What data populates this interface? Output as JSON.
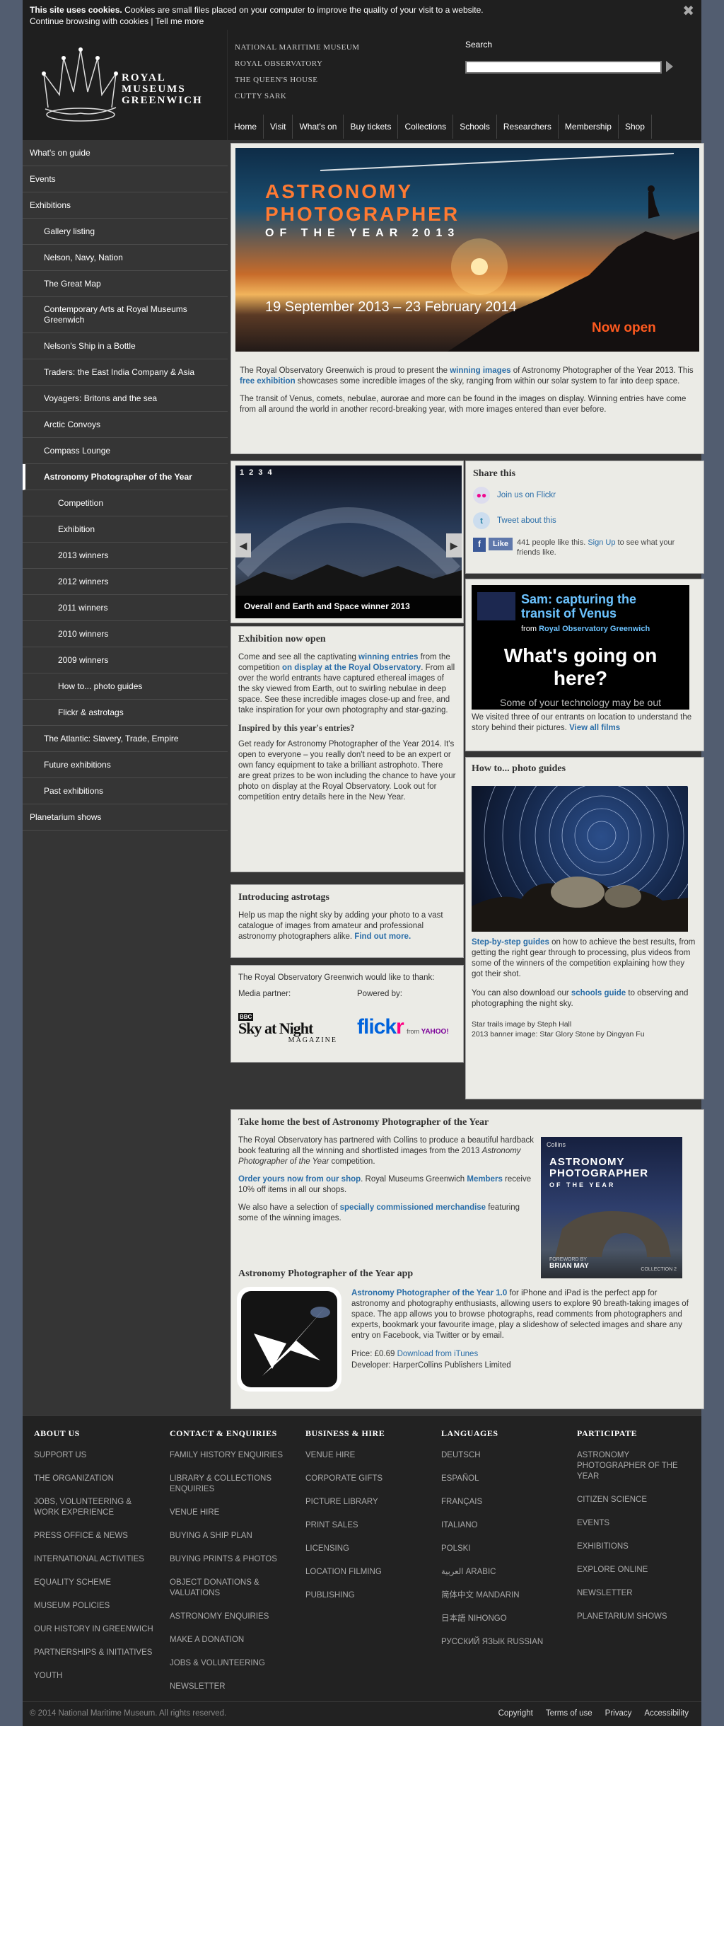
{
  "cookie": {
    "bold": "This site uses cookies.",
    "text": " Cookies are small files placed on your computer to improve the quality of your visit to a website.",
    "continue": "Continue browsing with cookies",
    "sep": " | ",
    "tell": "Tell me more",
    "close": "✖"
  },
  "logo": {
    "line1": "ROYAL",
    "line2": "MUSEUMS",
    "line3": "GREENWICH"
  },
  "sites": [
    "NATIONAL MARITIME MUSEUM",
    "ROYAL OBSERVATORY",
    "THE QUEEN'S HOUSE",
    "CUTTY SARK"
  ],
  "search": {
    "label": "Search"
  },
  "topnav": [
    "Home",
    "Visit",
    "What's on",
    "Buy tickets",
    "Collections",
    "Schools",
    "Researchers",
    "Membership",
    "Shop"
  ],
  "leftnav": [
    {
      "label": "What's on guide",
      "level": 1
    },
    {
      "label": "Events",
      "level": 1
    },
    {
      "label": "Exhibitions",
      "level": 1
    },
    {
      "label": "Gallery listing",
      "level": 2
    },
    {
      "label": "Nelson, Navy, Nation",
      "level": 2
    },
    {
      "label": "The Great Map",
      "level": 2
    },
    {
      "label": "Contemporary Arts at Royal Museums Greenwich",
      "level": 2
    },
    {
      "label": "Nelson's Ship in a Bottle",
      "level": 2
    },
    {
      "label": "Traders: the East India Company & Asia",
      "level": 2
    },
    {
      "label": "Voyagers: Britons and the sea",
      "level": 2
    },
    {
      "label": "Arctic Convoys",
      "level": 2
    },
    {
      "label": "Compass Lounge",
      "level": 2
    },
    {
      "label": "Astronomy Photographer of the Year",
      "level": 2,
      "active": true
    },
    {
      "label": "Competition",
      "level": 3
    },
    {
      "label": "Exhibition",
      "level": 3
    },
    {
      "label": "2013 winners",
      "level": 3
    },
    {
      "label": "2012 winners",
      "level": 3
    },
    {
      "label": "2011 winners",
      "level": 3
    },
    {
      "label": "2010 winners",
      "level": 3
    },
    {
      "label": "2009 winners",
      "level": 3
    },
    {
      "label": "How to... photo guides",
      "level": 3
    },
    {
      "label": "Flickr & astrotags",
      "level": 3
    },
    {
      "label": "The Atlantic: Slavery, Trade, Empire",
      "level": 2
    },
    {
      "label": "Future exhibitions",
      "level": 2
    },
    {
      "label": "Past exhibitions",
      "level": 2
    },
    {
      "label": "Planetarium shows",
      "level": 1
    }
  ],
  "hero": {
    "title1": "ASTRONOMY",
    "title2": "PHOTOGRAPHER",
    "subtitle": "OF THE YEAR 2013",
    "dates": "19 September 2013 – 23 February 2014",
    "open": "Now open"
  },
  "intro": {
    "p1a": "The Royal Observatory Greenwich is proud to present the ",
    "p1link": "winning images",
    "p1b": " of Astronomy Photographer of the Year 2013. This ",
    "p1link2": "free exhibition",
    "p1c": " showcases some incredible images of the sky, ranging from within our solar system to far into deep space.",
    "p2": "The transit of Venus, comets, nebulae, aurorae and more can be found in the images on display. Winning entries have come from all around the world in another record-breaking year, with more images entered than ever before."
  },
  "slider": {
    "dots": "1 2 3 4",
    "caption": "Overall and Earth and Space winner 2013",
    "prev": "◀",
    "next": "▶"
  },
  "share": {
    "title": "Share this",
    "flickr": "Join us on Flickr",
    "twitter": "Tweet about this",
    "like": "Like",
    "likes_a": "441 people like this. ",
    "signup": "Sign Up",
    "likes_b": " to see what your friends like."
  },
  "video": {
    "title1": "Sam: capturing the",
    "title2": "transit of Venus",
    "from": "from ",
    "channel": "Royal Observatory Greenwich",
    "overlay1": "What's going on",
    "overlay2": "here?",
    "overlay3": "Some of your technology may be out",
    "desc": "We visited three of our entrants on location to understand the story behind their pictures. ",
    "all": "View all films"
  },
  "exhibition": {
    "title": "Exhibition now open",
    "p1a": "Come and see all the captivating ",
    "p1link": "winning entries",
    "p1b": " from the competition ",
    "p1link2": "on display at the Royal Observatory",
    "p1c": ". From all over the world entrants have captured ethereal images of the sky viewed from Earth, out to swirling nebulae in deep space. See these incredible images close-up and free, and take inspiration for your own photography and star-gazing.",
    "sub": "Inspired by this year's entries?",
    "p2": "Get ready for Astronomy Photographer of the Year 2014. It's open to everyone – you really don't need to be an expert or own fancy equipment to take a brilliant astrophoto. There are great prizes to be won including the chance to have your photo on display at the Royal Observatory. Look out for competition entry details here in the New Year."
  },
  "astrotags": {
    "title": "Introducing astrotags",
    "p1": "Help us map the night sky by adding your photo to a vast catalogue of images from amateur and professional astronomy photographers alike. ",
    "link": "Find out more."
  },
  "thanks": {
    "intro": "The Royal Observatory Greenwich would like to thank:",
    "media": "Media partner:",
    "powered": "Powered by:",
    "bbc": "BBC",
    "sky1": "Sky at Night",
    "sky2": "MAGAZINE",
    "flickr1": "flick",
    "flickr2": "r",
    "from": "from ",
    "yahoo": "YAHOO!"
  },
  "howto": {
    "title": "How to... photo guides",
    "link": "Step-by-step guides",
    "p1": " on how to achieve the best results, from getting the right gear through to processing, plus videos from some of the winners of the competition explaining how they got their shot.",
    "p2a": "You can also download our ",
    "p2link": "schools guide",
    "p2b": " to observing and photographing the night sky.",
    "credit1": "Star trails image by Steph Hall",
    "credit2": "2013 banner image: Star Glory Stone by Dingyan Fu"
  },
  "book": {
    "title": "Take home the best of Astronomy Photographer of the Year",
    "p1a": "The Royal Observatory has partnered with Collins to produce a beautiful hardback book featuring all the winning and shortlisted images from the 2013 ",
    "p1i": "Astronomy Photographer of the Year",
    "p1b": " competition.",
    "p2link": "Order yours now from our shop",
    "p2a": ". Royal Museums Greenwich ",
    "p2link2": "Members",
    "p2b": " receive 10% off items in all our shops.",
    "p3a": "We also have a selection of ",
    "p3link": "specially commissioned merchandise",
    "p3b": " featuring some of the winning images.",
    "cover_pub": "Collins",
    "cover_t1": "ASTRONOMY",
    "cover_t2": "PHOTOGRAPHER",
    "cover_t3": "OF THE YEAR",
    "cover_fw": "FOREWORD BY",
    "cover_author": "BRIAN MAY",
    "cover_coll": "COLLECTION 2"
  },
  "app": {
    "title": "Astronomy Photographer of the Year app",
    "link": "Astronomy Photographer of the Year 1.0",
    "p1": " for iPhone and iPad is the perfect app for astronomy and photography enthusiasts, allowing users to explore 90 breath-taking images of space. The app allows you to browse photographs, read comments from photographers and experts, bookmark your favourite image, play a slideshow of selected images and share any entry on Facebook, via Twitter or by email.",
    "price": "Price: £0.69 ",
    "itunes": "Download from iTunes",
    "dev": "Developer: HarperCollins Publishers Limited"
  },
  "footer": {
    "cols": [
      {
        "title": "ABOUT US",
        "items": [
          "SUPPORT US",
          "THE ORGANIZATION",
          "JOBS, VOLUNTEERING & WORK EXPERIENCE",
          "PRESS OFFICE & NEWS",
          "INTERNATIONAL ACTIVITIES",
          "EQUALITY SCHEME",
          "MUSEUM POLICIES",
          "OUR HISTORY IN GREENWICH",
          "PARTNERSHIPS & INITIATIVES",
          "YOUTH"
        ]
      },
      {
        "title": "CONTACT & ENQUIRIES",
        "items": [
          "FAMILY HISTORY ENQUIRIES",
          "LIBRARY & COLLECTIONS ENQUIRIES",
          "VENUE HIRE",
          "BUYING A SHIP PLAN",
          "BUYING PRINTS & PHOTOS",
          "OBJECT DONATIONS & VALUATIONS",
          "ASTRONOMY ENQUIRIES",
          "MAKE A DONATION",
          "JOBS & VOLUNTEERING",
          "NEWSLETTER"
        ]
      },
      {
        "title": "BUSINESS & HIRE",
        "items": [
          "VENUE HIRE",
          "CORPORATE GIFTS",
          "PICTURE LIBRARY",
          "PRINT SALES",
          "LICENSING",
          "LOCATION FILMING",
          "PUBLISHING"
        ]
      },
      {
        "title": "LANGUAGES",
        "items": [
          "DEUTSCH",
          "ESPAÑOL",
          "FRANÇAIS",
          "ITALIANO",
          "POLSKI",
          "العربية ARABIC",
          "简体中文 MANDARIN",
          "日本語 NIHONGO",
          "РУССКИЙ ЯЗЫК RUSSIAN"
        ]
      },
      {
        "title": "PARTICIPATE",
        "items": [
          "ASTRONOMY PHOTOGRAPHER OF THE YEAR",
          "CITIZEN SCIENCE",
          "EVENTS",
          "EXHIBITIONS",
          "EXPLORE ONLINE",
          "NEWSLETTER",
          "PLANETARIUM SHOWS"
        ]
      }
    ],
    "copyright": "© 2014 National Maritime Museum. All rights reserved.",
    "links": [
      "Copyright",
      "Terms of use",
      "Privacy",
      "Accessibility"
    ]
  }
}
